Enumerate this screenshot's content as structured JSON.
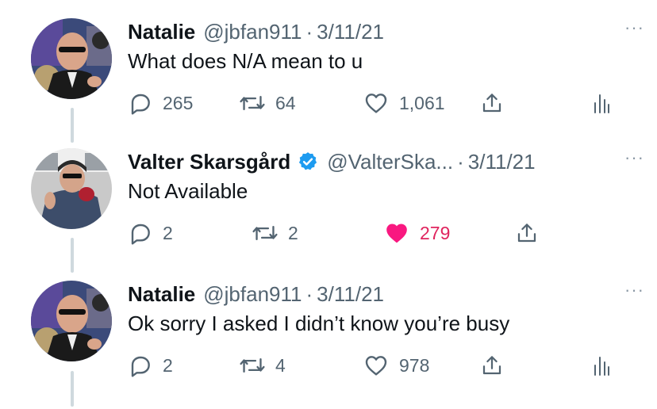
{
  "tweets": [
    {
      "name": "Natalie",
      "handle": "@jbfan911",
      "date": "3/11/21",
      "text": "What does N/A mean to u",
      "replies": "265",
      "retweets": "64",
      "likes": "1,061",
      "liked": false,
      "verified": false,
      "avatar": "natalie-avatar"
    },
    {
      "name": "Valter Skarsgård",
      "handle": "@ValterSka...",
      "date": "3/11/21",
      "text": "Not Available",
      "replies": "2",
      "retweets": "2",
      "likes": "279",
      "liked": true,
      "verified": true,
      "avatar": "valter-avatar"
    },
    {
      "name": "Natalie",
      "handle": "@jbfan911",
      "date": "3/11/21",
      "text": "Ok sorry I asked I didn’t know you’re busy",
      "replies": "2",
      "retweets": "4",
      "likes": "978",
      "liked": false,
      "verified": false,
      "avatar": "natalie-avatar"
    }
  ],
  "icons": {
    "reply": "reply-icon",
    "retweet": "retweet-icon",
    "like": "heart-icon",
    "share": "share-icon",
    "analytics": "analytics-icon",
    "more": "more-icon",
    "verified": "verified-badge-icon"
  },
  "colors": {
    "text": "#0f1419",
    "secondary": "#536471",
    "like_active": "#f91880",
    "verified": "#1d9bf0",
    "thread_line": "#cfd9de"
  },
  "more_glyph": "···",
  "separator": "·"
}
